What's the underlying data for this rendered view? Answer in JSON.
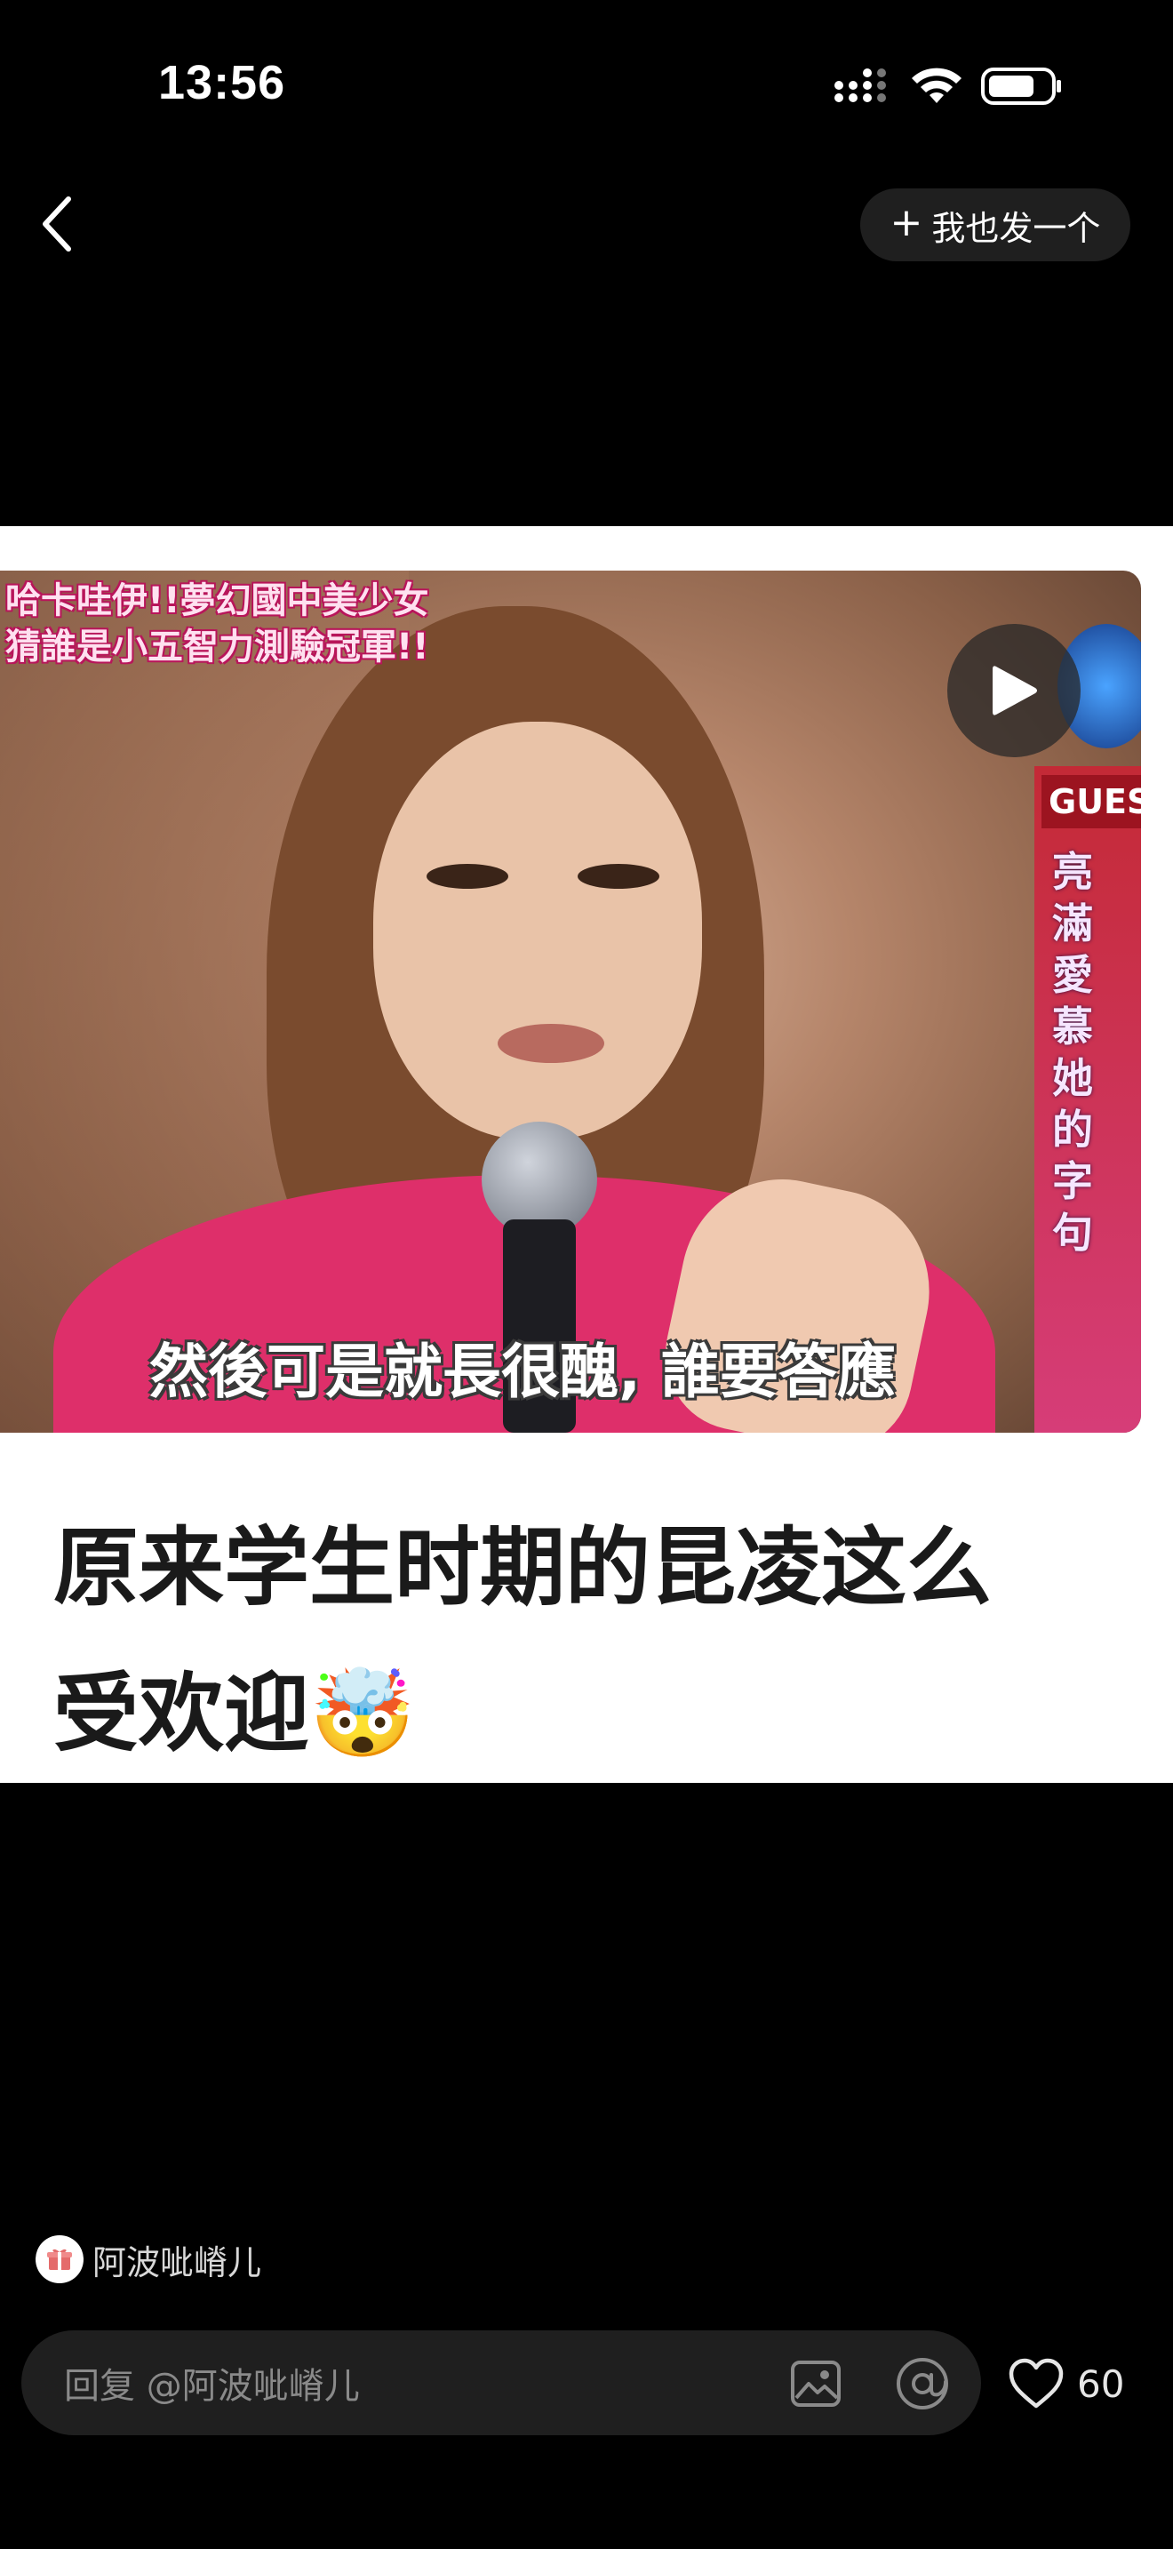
{
  "status_bar": {
    "time": "13:56",
    "icons": [
      "cellular-signal-icon",
      "wifi-icon",
      "battery-icon"
    ]
  },
  "nav": {
    "back_icon": "chevron-left-icon",
    "post_button_icon": "plus-icon",
    "post_button_plus": "+",
    "post_button_label": "我也发一个"
  },
  "post": {
    "video_top_caption": "哈卡哇伊!!夢幻國中美少女\n猜誰是小五智力測驗冠軍!!",
    "video_guest_tag": "GUES",
    "video_side_text": "亮滿愛慕她的字句",
    "video_subtitle": "然後可是就長很醜, 誰要答應",
    "play_icon": "play-icon",
    "title": "原来学生时期的昆凌这么受欢迎🤯"
  },
  "author": {
    "avatar_icon": "gift-icon",
    "name": "阿波呲嵴儿"
  },
  "bottom_bar": {
    "reply_placeholder": "回复 @阿波呲嵴儿",
    "image_icon": "image-icon",
    "at_icon": "at-icon",
    "like_icon": "heart-icon",
    "like_count": "60"
  },
  "colors": {
    "background": "#000000",
    "card": "#ffffff",
    "input_bg": "#1f1f1f",
    "title_text": "#1a1a1a"
  }
}
